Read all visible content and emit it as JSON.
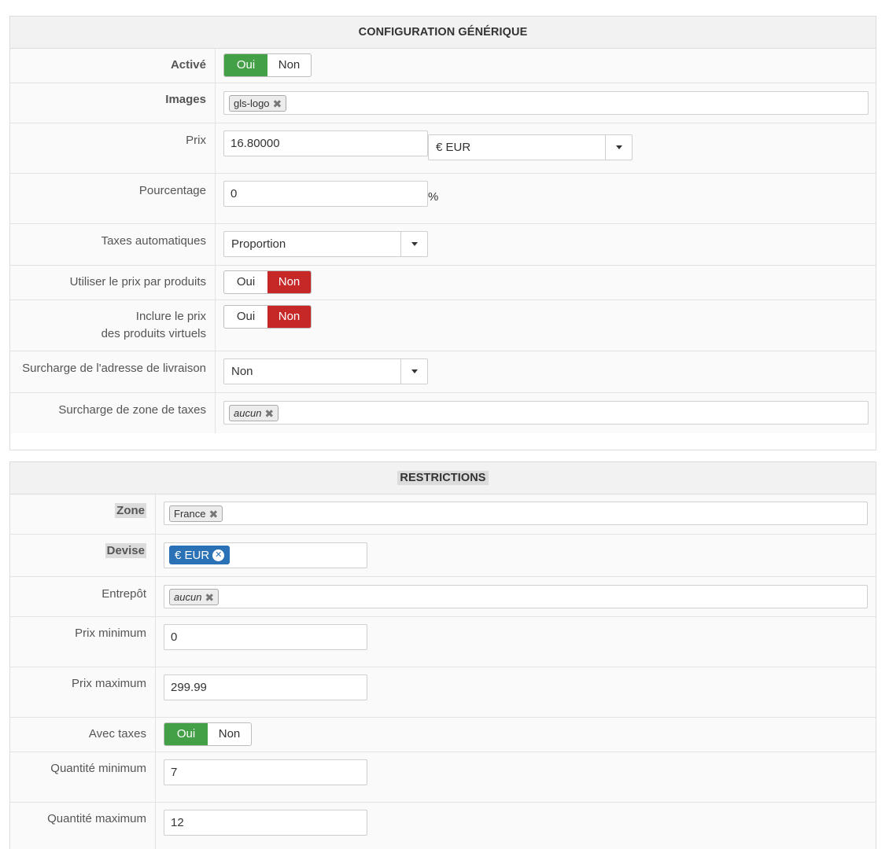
{
  "generic": {
    "title": "CONFIGURATION GÉNÉRIQUE",
    "active": {
      "label": "Activé",
      "yes": "Oui",
      "no": "Non",
      "selected": "yes"
    },
    "images": {
      "label": "Images",
      "tag": "gls-logo"
    },
    "price": {
      "label": "Prix",
      "value": "16.80000",
      "currency": "€ EUR"
    },
    "percentage": {
      "label": "Pourcentage",
      "value": "0",
      "suffix": "%"
    },
    "auto_taxes": {
      "label": "Taxes automatiques",
      "value": "Proportion"
    },
    "use_product_price": {
      "label": "Utiliser le prix par produits",
      "yes": "Oui",
      "no": "Non",
      "selected": "no"
    },
    "include_virtual": {
      "label_line1": "Inclure le prix",
      "label_line2": "des produits virtuels",
      "yes": "Oui",
      "no": "Non",
      "selected": "no"
    },
    "address_override": {
      "label": "Surcharge de l'adresse de livraison",
      "value": "Non"
    },
    "tax_zone_override": {
      "label": "Surcharge de zone de taxes",
      "tag": "aucun"
    }
  },
  "restrictions": {
    "title": "RESTRICTIONS",
    "zone": {
      "label": "Zone",
      "tag": "France"
    },
    "currency": {
      "label": "Devise",
      "tag": "€ EUR"
    },
    "warehouse": {
      "label": "Entrepôt",
      "tag": "aucun"
    },
    "min_price": {
      "label": "Prix minimum",
      "value": "0"
    },
    "max_price": {
      "label": "Prix maximum",
      "value": "299.99"
    },
    "with_taxes": {
      "label": "Avec taxes",
      "yes": "Oui",
      "no": "Non",
      "selected": "yes"
    },
    "min_qty": {
      "label": "Quantité minimum",
      "value": "7"
    },
    "max_qty": {
      "label": "Quantité maximum",
      "value": "12"
    }
  },
  "colors": {
    "green": "#43a047",
    "red": "#c62828",
    "blue": "#2a72b5"
  }
}
